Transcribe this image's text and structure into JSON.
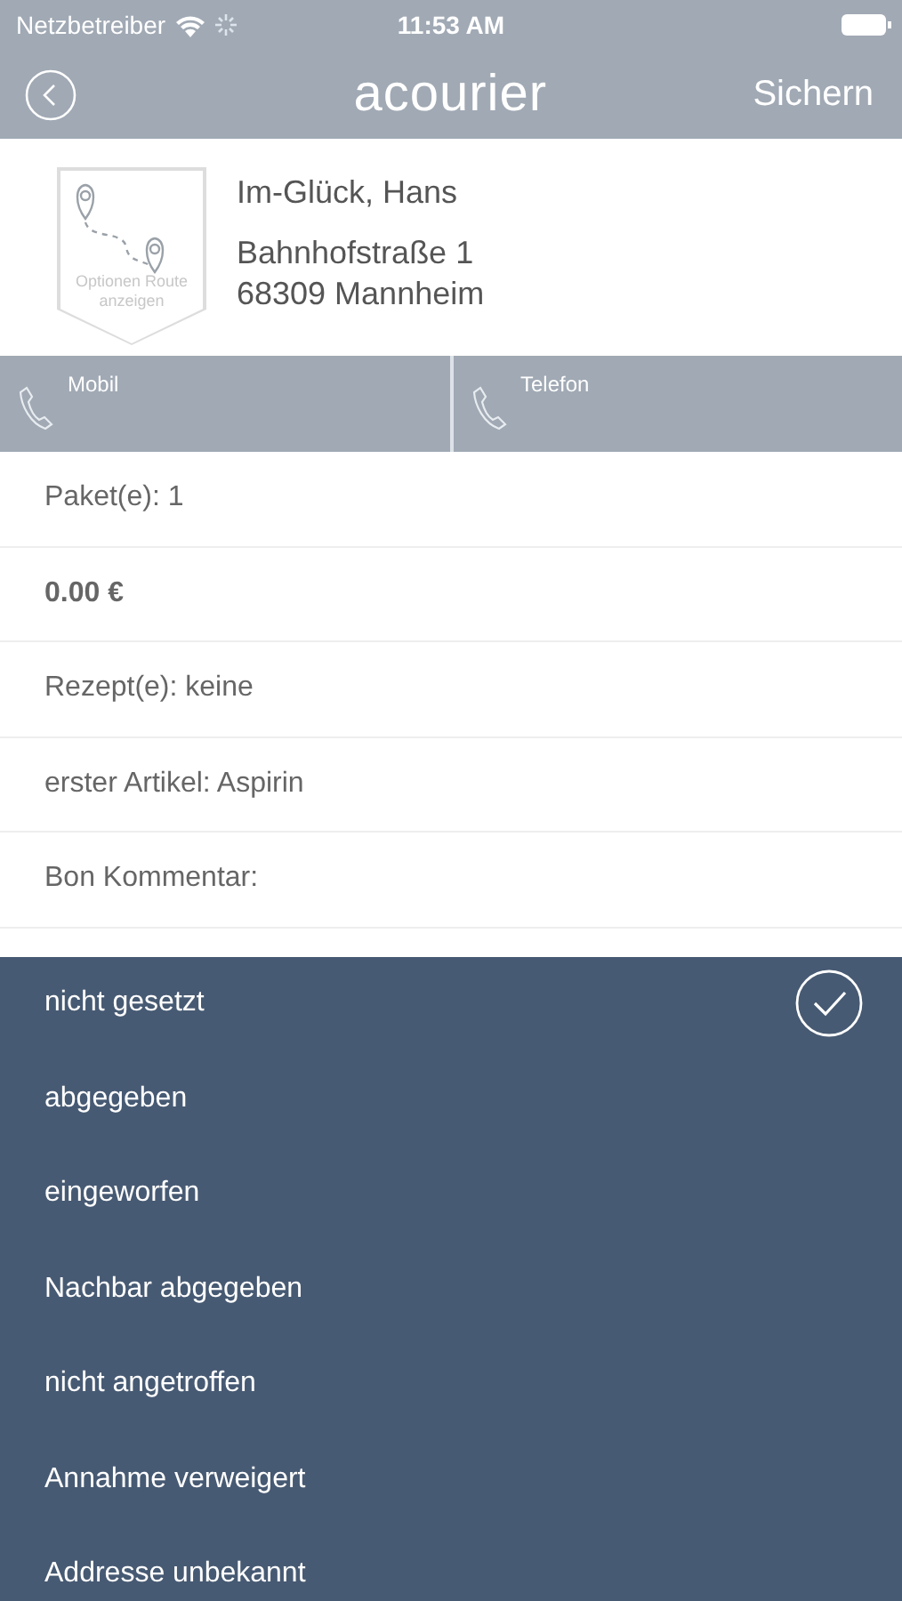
{
  "status_bar": {
    "carrier": "Netzbetreiber",
    "time": "11:53 AM"
  },
  "nav": {
    "title": "acourier",
    "action": "Sichern"
  },
  "recipient": {
    "route_label": "Optionen Route anzeigen",
    "name": "Im-Glück, Hans",
    "street": "Bahnhofstraße 1",
    "city": "68309 Mannheim"
  },
  "phone_buttons": [
    "Mobil",
    "Telefon"
  ],
  "details": [
    {
      "kind": "text",
      "text": "Paket(e): 1"
    },
    {
      "kind": "amount",
      "text": "0.00 €"
    },
    {
      "kind": "text",
      "text": "Rezept(e): keine"
    },
    {
      "kind": "text",
      "text": "erster Artikel: Aspirin"
    },
    {
      "kind": "text",
      "text": "Bon Kommentar:"
    }
  ],
  "status_options": [
    {
      "label": "nicht gesetzt",
      "selected": true
    },
    {
      "label": "abgegeben",
      "selected": false
    },
    {
      "label": "eingeworfen",
      "selected": false
    },
    {
      "label": "Nachbar abgegeben",
      "selected": false
    },
    {
      "label": "nicht angetroffen",
      "selected": false
    },
    {
      "label": "Annahme verweigert",
      "selected": false
    },
    {
      "label": "Addresse unbekannt",
      "selected": false
    }
  ]
}
